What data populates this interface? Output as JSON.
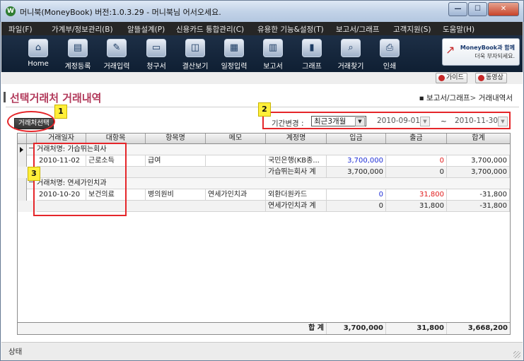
{
  "window": {
    "title": "머니북(MoneyBook) 버전:1.0.3.29 - 머니북님 어서오세요.",
    "app_icon": "W",
    "controls": {
      "minimize": "—",
      "maximize": "☐",
      "close": "✕"
    }
  },
  "menu": [
    "파일(F)",
    "가계부/정보관리(B)",
    "알뜰설계(P)",
    "신용카드 통합관리(C)",
    "유용한 기능&설정(T)",
    "보고서/그래프",
    "고객지원(S)",
    "도움말(H)"
  ],
  "toolbar": [
    {
      "label": "Home",
      "icon": "home-icon",
      "glyph": "⌂"
    },
    {
      "label": "계정등록",
      "icon": "account-register-icon",
      "glyph": "▤"
    },
    {
      "label": "거래입력",
      "icon": "edit-icon",
      "glyph": "✎"
    },
    {
      "label": "청구서",
      "icon": "card-icon",
      "glyph": "▭"
    },
    {
      "label": "결산보기",
      "icon": "monitor-icon",
      "glyph": "◫"
    },
    {
      "label": "일정입력",
      "icon": "calendar-icon",
      "glyph": "▦"
    },
    {
      "label": "보고서",
      "icon": "report-icon",
      "glyph": "▥"
    },
    {
      "label": "그래프",
      "icon": "bar-chart-icon",
      "glyph": "▮"
    },
    {
      "label": "거래찾기",
      "icon": "search-icon",
      "glyph": "⌕"
    },
    {
      "label": "인쇄",
      "icon": "printer-icon",
      "glyph": "⎙"
    }
  ],
  "banner": {
    "line1": "MoneyBook과 함께",
    "line2": "더욱 부자되세요."
  },
  "subbar": {
    "guide": "가이드",
    "video": "동영상"
  },
  "page": {
    "title": "선택거래처 거래내역",
    "breadcrumb_root": "보고서/그래프",
    "breadcrumb_sep": ">",
    "breadcrumb_leaf": "거래내역서"
  },
  "filters": {
    "select_button": "거래처선택",
    "period_label": "기간변경 :",
    "period_value": "최근3개월",
    "date_from": "2010-09-01",
    "tilde": "~",
    "date_to": "2010-11-30"
  },
  "grid": {
    "columns": [
      "거래일자",
      "대항목",
      "항목명",
      "메모",
      "계정명",
      "입금",
      "출금",
      "합계"
    ],
    "groups": [
      {
        "header": "거래처명: 가습뛰는회사",
        "rows": [
          {
            "date": "2010-11-02",
            "major": "근로소득",
            "item": "급여",
            "memo": "",
            "account": "국민은행(KB종...",
            "deposit": "3,700,000",
            "withdraw": "0",
            "total": "3,700,000"
          }
        ],
        "subtotal": {
          "label": "가습뛰는회사 계",
          "deposit": "3,700,000",
          "withdraw": "0",
          "total": "3,700,000"
        }
      },
      {
        "header": "거래처명: 연세가인치과",
        "rows": [
          {
            "date": "2010-10-20",
            "major": "보건의료",
            "item": "병의원비",
            "memo": "연세가인치과",
            "account": "외환더원카드",
            "deposit": "0",
            "withdraw": "31,800",
            "total": "-31,800"
          }
        ],
        "subtotal": {
          "label": "연세가인치과 계",
          "deposit": "0",
          "withdraw": "31,800",
          "total": "-31,800"
        }
      }
    ],
    "footer": {
      "label": "합 계",
      "deposit": "3,700,000",
      "withdraw": "31,800",
      "total": "3,668,200"
    }
  },
  "annotations": {
    "n1": "1",
    "n2": "2",
    "n3": "3"
  },
  "status": {
    "text": "상태"
  },
  "colors": {
    "deposit": "#1f2fd6",
    "withdraw": "#e01b1b",
    "accent_title": "#b23a5b",
    "annotation": "#e5262a"
  }
}
